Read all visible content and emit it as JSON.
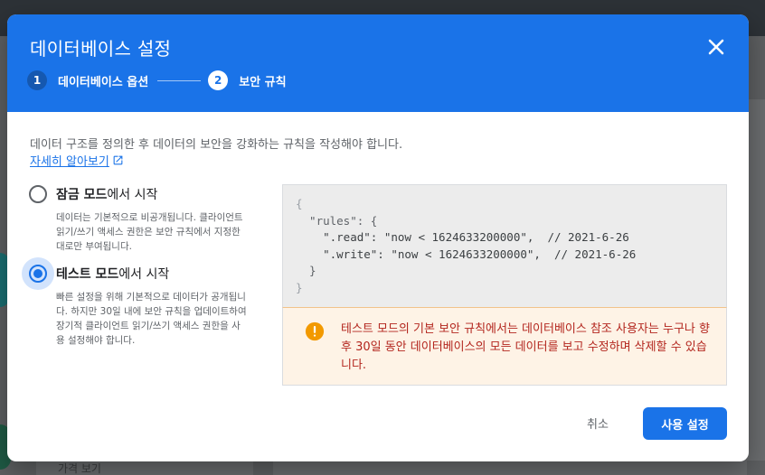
{
  "backdrop": {
    "bottom_link": "가격 보기"
  },
  "dialog": {
    "title": "데이터베이스 설정",
    "close_icon": "close-icon",
    "steps": [
      {
        "number": "1",
        "label": "데이터베이스 옵션",
        "state": "completed"
      },
      {
        "number": "2",
        "label": "보안 규칙",
        "state": "active"
      }
    ],
    "intro": "데이터 구조를 정의한 후 데이터의 보안을 강화하는 규칙을 작성해야 합니다.",
    "learn_more": "자세히 알아보기",
    "learn_more_icon": "open-in-new-icon",
    "options": [
      {
        "title_bold": "잠금 모드",
        "title_rest": "에서 시작",
        "description": "데이터는 기본적으로 비공개됩니다. 클라이언트 읽기/쓰기 액세스 권한은 보안 규칙에서 지정한 대로만 부여됩니다.",
        "selected": false
      },
      {
        "title_bold": "테스트 모드",
        "title_rest": "에서 시작",
        "description": "빠른 설정을 위해 기본적으로 데이터가 공개됩니다. 하지만 30일 내에 보안 규칙을 업데이트하여 장기적 클라이언트 읽기/쓰기 액세스 권한을 사용 설정해야 합니다.",
        "selected": true
      }
    ],
    "code": {
      "line1": "{",
      "line2": "  \"rules\": {",
      "line3": "    \".read\": \"now < 1624633200000\",  // 2021-6-26",
      "line4": "    \".write\": \"now < 1624633200000\",  // 2021-6-26",
      "line5": "  }",
      "line6": "}"
    },
    "warning": {
      "icon": "warning-icon",
      "text": "테스트 모드의 기본 보안 규칙에서는 데이터베이스 참조 사용자는 누구나 향후 30일 동안 데이터베이스의 모든 데이터를 보고 수정하며 삭제할 수 있습니다."
    },
    "cancel_label": "취소",
    "enable_label": "사용 설정"
  },
  "colors": {
    "header_blue": "#1a73e8",
    "warning_bg": "#fef3e6",
    "warning_text": "#b3261e",
    "warning_icon": "#f29900"
  }
}
